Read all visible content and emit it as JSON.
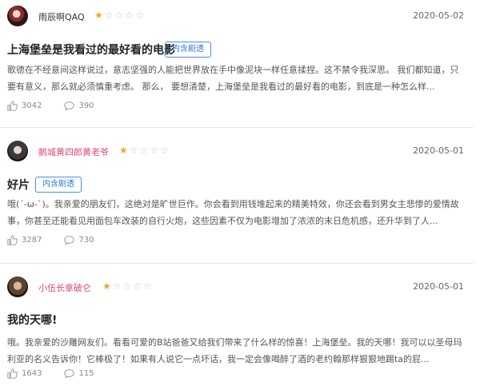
{
  "reviews": [
    {
      "username": "雨辰啊QAQ",
      "rating": 1,
      "date": "2020-05-02",
      "title": "上海堡垒是我看过的最好看的电影",
      "spoiler_tag": "内含剧透",
      "body": "歌德在不经意间这样说过，意志坚强的人能把世界放在手中像泥块一样任意揉捏。这不禁令我深思。 我们都知道，只要有意义，那么就必须慎重考虑。 那么， 要想清楚，上海堡垒是我看过的最好看的电影，到底是一种怎么样...",
      "likes": "3042",
      "comments": "390"
    },
    {
      "username": "鹅城黄四郎黄老爷",
      "rating": 1,
      "date": "2020-05-01",
      "title": "好片",
      "spoiler_tag": "内含剧透",
      "body": "哦(´-ω-`)。我亲爱的朋友们，这绝对是旷世巨作。你会看到用钱堆起来的精美特效，你还会看到男女主悲惨的爱情故事，你甚至还能看见用面包车改装的自行火炮，这些因素不仅为电影增加了浓浓的末日危机感，还升华到了人...",
      "likes": "3287",
      "comments": "730"
    },
    {
      "username": "小伍长拿破仑",
      "rating": 1,
      "date": "2020-05-01",
      "title": "我的天哪!",
      "body": "哦。我亲爱的沙雕网友们。看看可爱的B站爸爸又给我们带来了什么样的惊喜！上海堡垒。我的天哪！我可以以圣母玛利亚的名义告诉你！它棒极了！如果有人说它一点坏话，我一定会像喝醉了酒的老约翰那样狠狠地踢ta的屁...",
      "likes": "1643",
      "comments": "115"
    }
  ],
  "colors": {
    "star_active": "#f5a623",
    "star_inactive": "#c9c9c9",
    "tag_blue": "#4a90e2",
    "username_pink": "#e1467c"
  },
  "icons": {
    "like": "thumbs-up-icon",
    "comment": "comment-bubble-icon",
    "star": "star-icon"
  }
}
